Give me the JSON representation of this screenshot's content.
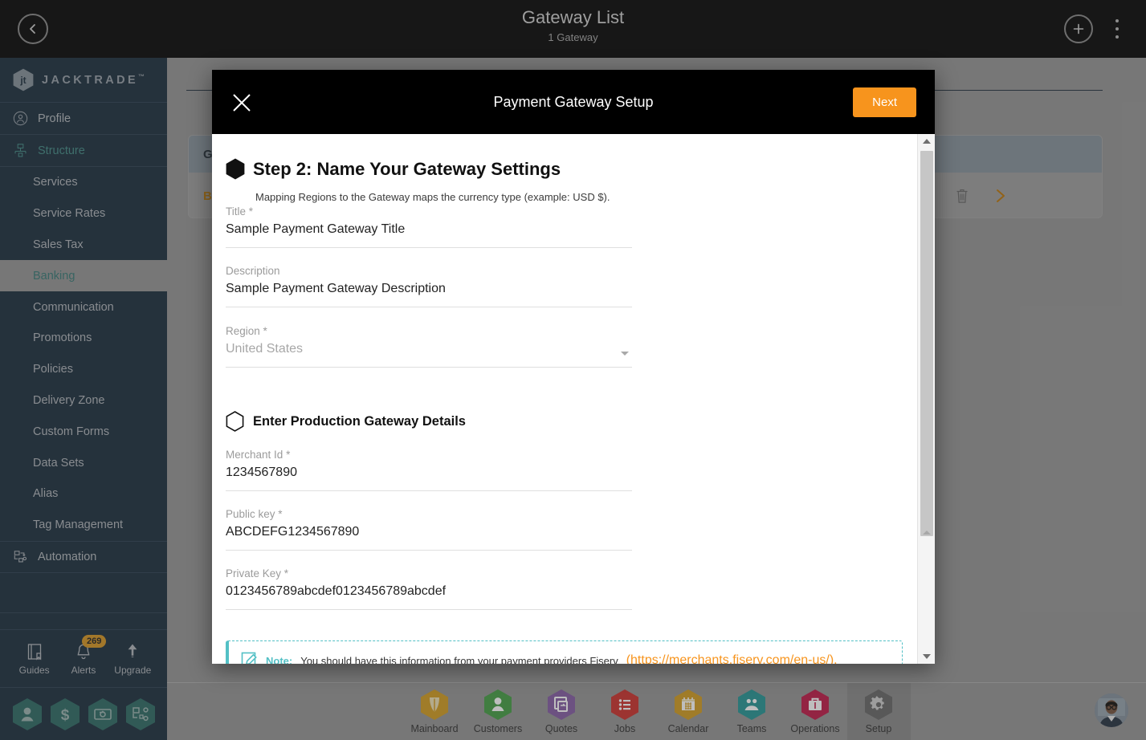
{
  "topbar": {
    "back_icon": "chevron-left-icon",
    "title": "Gateway List",
    "subtitle": "1 Gateway",
    "add_icon": "plus-circle-icon",
    "menu_icon": "kebab-menu-icon"
  },
  "sidebar": {
    "brand": "JACKTRADE",
    "brand_tm": "™",
    "groups": [
      {
        "label": "Profile",
        "icon": "user-circle-icon",
        "accent": false
      },
      {
        "label": "Structure",
        "icon": "structure-icon",
        "accent": true
      }
    ],
    "items": [
      {
        "label": "Services",
        "active": false
      },
      {
        "label": "Service Rates",
        "active": false
      },
      {
        "label": "Sales Tax",
        "active": false
      },
      {
        "label": "Banking",
        "active": true
      },
      {
        "label": "Communication",
        "active": false
      },
      {
        "label": "Promotions",
        "active": false
      },
      {
        "label": "Policies",
        "active": false
      },
      {
        "label": "Delivery Zone",
        "active": false
      },
      {
        "label": "Custom Forms",
        "active": false
      },
      {
        "label": "Data Sets",
        "active": false
      },
      {
        "label": "Alias",
        "active": false
      },
      {
        "label": "Tag Management",
        "active": false
      }
    ],
    "automation": {
      "label": "Automation",
      "icon": "automation-icon"
    },
    "tools": [
      {
        "label": "Guides",
        "icon": "book-icon",
        "badge": ""
      },
      {
        "label": "Alerts",
        "icon": "bell-icon",
        "badge": "269"
      },
      {
        "label": "Upgrade",
        "icon": "arrow-up-icon",
        "badge": ""
      }
    ],
    "quick_hexes": [
      {
        "icon": "person-hex-icon"
      },
      {
        "icon": "dollar-hex-icon"
      },
      {
        "icon": "money-transfer-hex-icon"
      },
      {
        "icon": "workflow-hex-icon"
      }
    ]
  },
  "background": {
    "card_header": "Ga",
    "card_row": "Br",
    "delete_icon": "trash-icon",
    "open_icon": "chevron-right-icon"
  },
  "modal": {
    "close_icon": "close-icon",
    "title": "Payment Gateway Setup",
    "next_label": "Next",
    "step": {
      "hex_icon": "hexagon-filled-icon",
      "title": "Step 2: Name Your Gateway Settings",
      "subtitle": "Mapping Regions to the Gateway maps the currency type (example: USD $)."
    },
    "fields": [
      {
        "label": "Title",
        "required": true,
        "value": "Sample Payment Gateway Title",
        "is_placeholder": false,
        "type": "text"
      },
      {
        "label": "Description",
        "required": false,
        "value": "Sample Payment Gateway Description",
        "is_placeholder": false,
        "type": "text"
      },
      {
        "label": "Region",
        "required": true,
        "value": "United States",
        "is_placeholder": true,
        "type": "select"
      }
    ],
    "section": {
      "hex_icon": "hexagon-outline-icon",
      "title": "Enter Production Gateway Details"
    },
    "prod_fields": [
      {
        "label": "Merchant Id",
        "required": true,
        "value": "1234567890",
        "is_placeholder": false,
        "type": "text"
      },
      {
        "label": "Public key",
        "required": true,
        "value": "ABCDEFG1234567890",
        "is_placeholder": false,
        "type": "text"
      },
      {
        "label": "Private Key",
        "required": true,
        "value": "0123456789abcdef0123456789abcdef",
        "is_placeholder": false,
        "type": "text"
      }
    ],
    "note": {
      "icon": "note-edit-icon",
      "label": "Note:",
      "text": "You should have this information from your payment providers Fiserv",
      "link": "(https://merchants.fiserv.com/en-us/).",
      "accent_color": "#53c0c5"
    },
    "scrollbar": {
      "up_icon": "scroll-up-arrow-icon",
      "down_icon": "scroll-down-arrow-icon"
    }
  },
  "bottomnav": {
    "items": [
      {
        "label": "Mainboard",
        "icon": "mainboard-icon",
        "color": "#d4a12a",
        "selected": false
      },
      {
        "label": "Customers",
        "icon": "customers-icon",
        "color": "#4ca24c",
        "selected": false
      },
      {
        "label": "Quotes",
        "icon": "quotes-icon",
        "color": "#8a63a8",
        "selected": false
      },
      {
        "label": "Jobs",
        "icon": "jobs-icon",
        "color": "#cf3a36",
        "selected": false
      },
      {
        "label": "Calendar",
        "icon": "calendar-icon",
        "color": "#d4a12a",
        "selected": false
      },
      {
        "label": "Teams",
        "icon": "teams-icon",
        "color": "#2f9a9a",
        "selected": false
      },
      {
        "label": "Operations",
        "icon": "operations-icon",
        "color": "#c22350",
        "selected": false
      },
      {
        "label": "Setup",
        "icon": "setup-gear-icon",
        "color": "#6e6e6e",
        "selected": true
      }
    ],
    "avatar_icon": "user-avatar"
  },
  "colors": {
    "brand_orange": "#f7941d",
    "sidebar_bg": "#253746",
    "teal": "#4a8f8a",
    "note_teal": "#53c0c5"
  }
}
